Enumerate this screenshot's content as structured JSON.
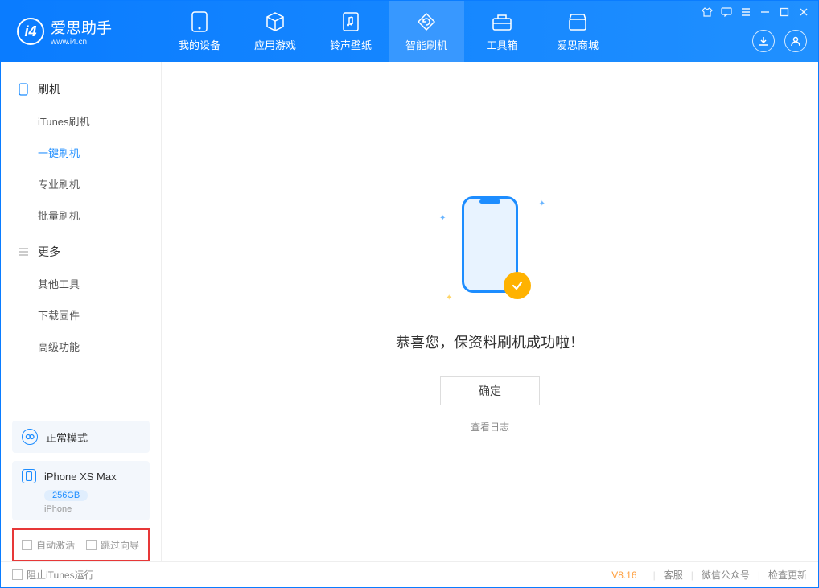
{
  "app": {
    "title": "爱思助手",
    "url": "www.i4.cn"
  },
  "nav": {
    "tabs": [
      {
        "label": "我的设备",
        "icon": "device"
      },
      {
        "label": "应用游戏",
        "icon": "cube"
      },
      {
        "label": "铃声壁纸",
        "icon": "music"
      },
      {
        "label": "智能刷机",
        "icon": "refresh",
        "active": true
      },
      {
        "label": "工具箱",
        "icon": "toolbox"
      },
      {
        "label": "爱思商城",
        "icon": "shop"
      }
    ]
  },
  "sidebar": {
    "sections": [
      {
        "title": "刷机",
        "items": [
          {
            "label": "iTunes刷机"
          },
          {
            "label": "一键刷机",
            "active": true
          },
          {
            "label": "专业刷机"
          },
          {
            "label": "批量刷机"
          }
        ]
      },
      {
        "title": "更多",
        "items": [
          {
            "label": "其他工具"
          },
          {
            "label": "下载固件"
          },
          {
            "label": "高级功能"
          }
        ]
      }
    ],
    "mode": {
      "label": "正常模式"
    },
    "device": {
      "name": "iPhone XS Max",
      "capacity": "256GB",
      "type": "iPhone"
    },
    "checkboxes": {
      "auto_activate": "自动激活",
      "skip_guide": "跳过向导"
    }
  },
  "main": {
    "success_text": "恭喜您，保资料刷机成功啦！",
    "ok_button": "确定",
    "view_log": "查看日志"
  },
  "statusbar": {
    "block_itunes": "阻止iTunes运行",
    "version": "V8.16",
    "links": [
      "客服",
      "微信公众号",
      "检查更新"
    ]
  }
}
